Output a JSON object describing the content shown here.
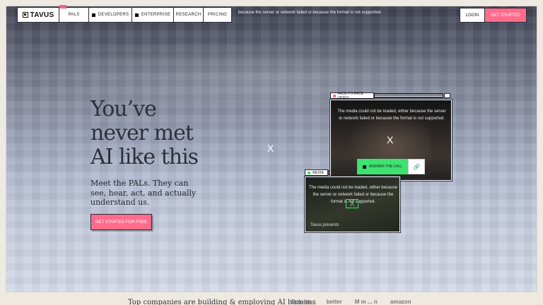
{
  "nav": {
    "logo": "TAVUS",
    "items": [
      {
        "label": "PALS",
        "has_square": false,
        "tag": ""
      },
      {
        "label": "DEVELOPERS",
        "has_square": true
      },
      {
        "label": "ENTERPRISE",
        "has_square": true
      },
      {
        "label": "RESEARCH",
        "has_square": false
      },
      {
        "label": "PRICING",
        "has_square": false
      }
    ],
    "error_text": "because the server or network failed or because the format is not supported.",
    "login": "LOGIN",
    "get_started": "GET STARTED"
  },
  "hero": {
    "headline_lines": [
      "You’ve",
      "never met",
      "AI like this"
    ],
    "subtext": "Meet the PALs. They can see, hear, act, and actually understand us.",
    "cta": "GET STARTED FOR FREE",
    "overlay_close": "X"
  },
  "video_window": {
    "tab_label": "FACE-TO-FACE VIDEO",
    "message": "The media could not be loaded, either because the server or network failed or because the format is not supported.",
    "close": "X",
    "answer_button": "ANSWER THE CALL",
    "link_icon": "link-icon"
  },
  "media_window": {
    "tab_label": "MEDIA",
    "message": "The media could not be loaded, either because the server or network failed or because the format is not supported.",
    "close": "X",
    "caption": "Tavus presents"
  },
  "footer_strip": {
    "headline": "Top companies are building & employing AI humans",
    "logos": [
      "Deloitte.",
      "better",
      "M m ... n",
      "amazon"
    ]
  },
  "colors": {
    "accent_pink": "#ff6b8b",
    "accent_green": "#3ee26f"
  }
}
